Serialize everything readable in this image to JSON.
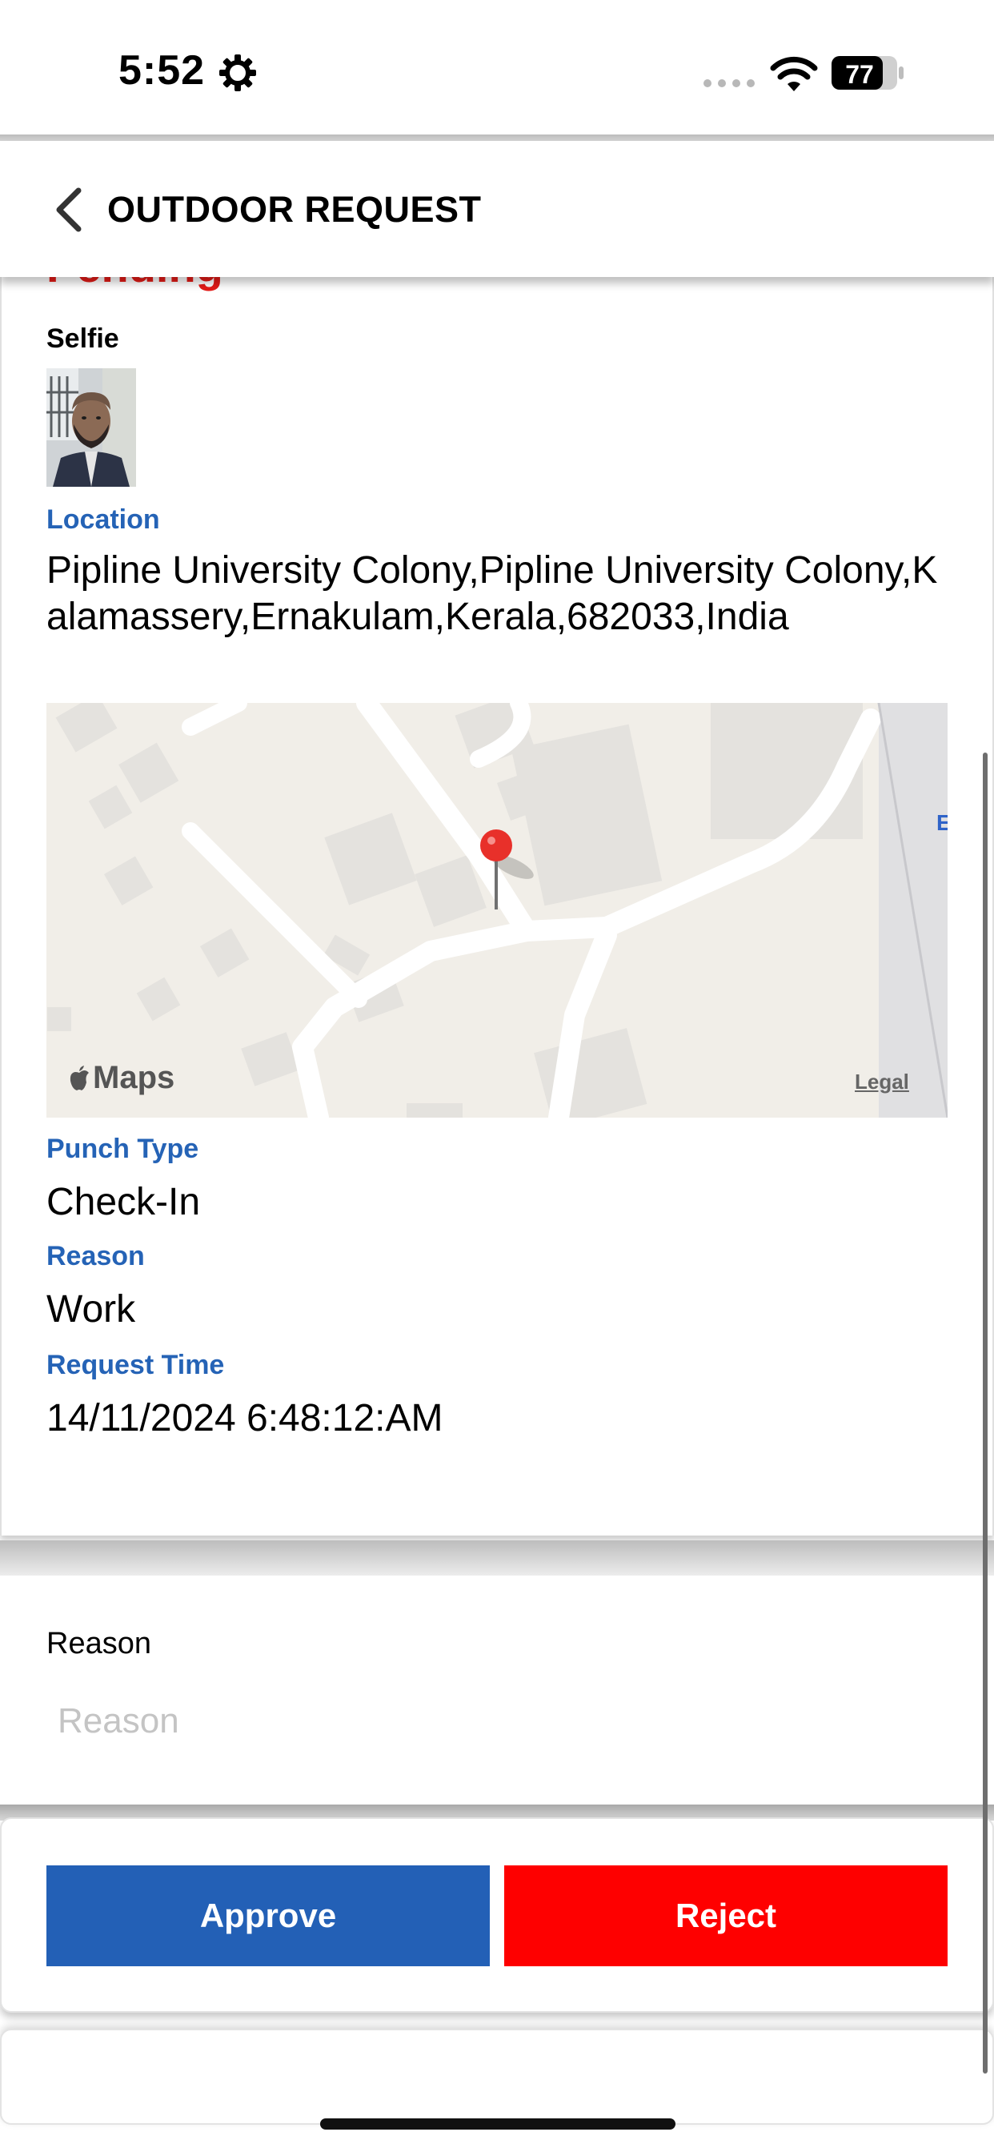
{
  "status_bar": {
    "time": "5:52",
    "battery": "77"
  },
  "header": {
    "title": "OUTDOOR REQUEST"
  },
  "request": {
    "status": "Pending",
    "selfie_label": "Selfie",
    "location_label": "Location",
    "location_value": "Pipline University Colony,Pipline University Colony,Kalamassery,Ernakulam,Kerala,682033,India",
    "map_brand": "Maps",
    "map_legal": "Legal",
    "map_edge_label": "E",
    "punch_type_label": "Punch Type",
    "punch_type_value": "Check-In",
    "reason_label": "Reason",
    "reason_value": "Work",
    "request_time_label": "Request Time",
    "request_time_value": "14/11/2024 6:48:12:AM"
  },
  "review": {
    "reason_label": "Reason",
    "reason_placeholder": "Reason",
    "reason_value": ""
  },
  "actions": {
    "approve_label": "Approve",
    "reject_label": "Reject"
  },
  "colors": {
    "label_blue": "#2563b6",
    "approve_blue": "#2360b6",
    "reject_red": "#fe0000",
    "status_red": "#e41b17"
  }
}
